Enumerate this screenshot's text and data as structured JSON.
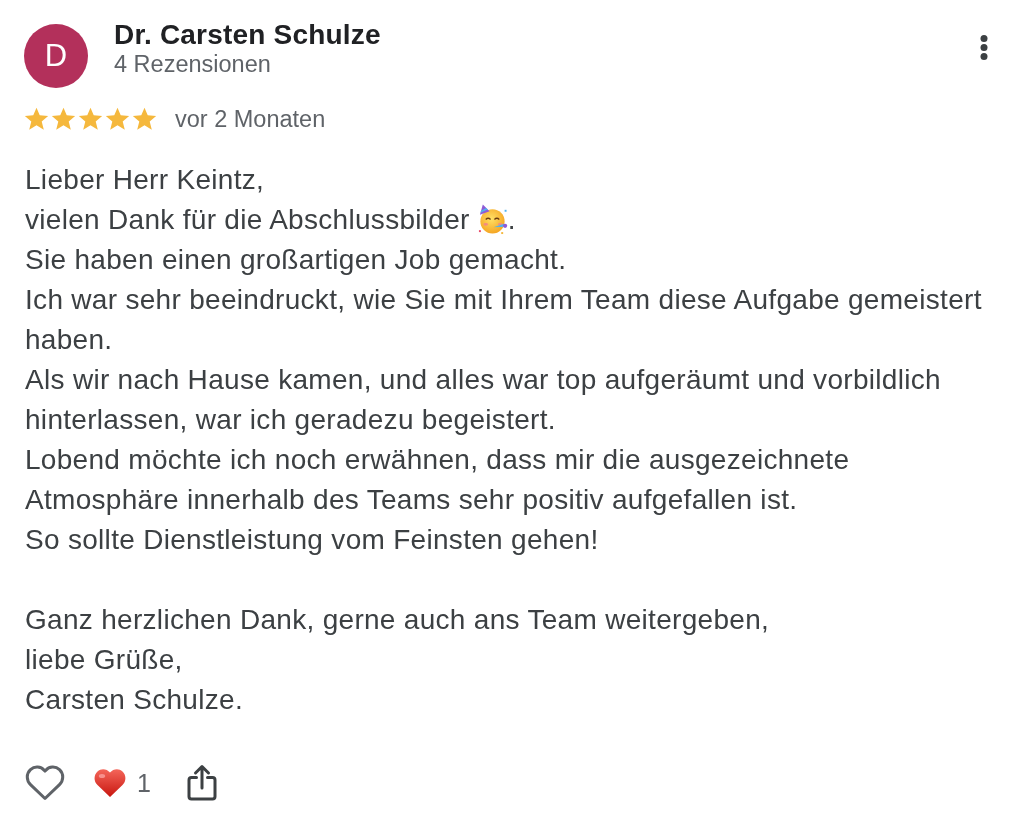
{
  "reviewer": {
    "avatar_letter": "D",
    "name": "Dr. Carsten Schulze",
    "review_count": "4 Rezensionen"
  },
  "rating": {
    "stars": 5,
    "time": "vor 2 Monaten"
  },
  "body": {
    "paragraphs": [
      [
        {
          "kind": "text",
          "text": "Lieber Herr Keintz,"
        },
        {
          "kind": "emoji",
          "text": "vielen Dank für die Abschlussbilder",
          "after": "."
        },
        {
          "kind": "text",
          "text": "Sie haben einen großartigen Job gemacht."
        },
        {
          "kind": "text",
          "text": "Ich war sehr beeindruckt, wie Sie mit Ihrem Team diese Aufgabe gemeistert\nhaben."
        },
        {
          "kind": "text",
          "text": "Als wir nach Hause kamen, und alles war top aufgeräumt und vorbildlich\nhinterlassen, war ich geradezu begeistert."
        },
        {
          "kind": "text",
          "text": "Lobend möchte ich noch erwähnen, dass mir die ausgezeichnete\nAtmosphäre innerhalb des Teams sehr positiv aufgefallen ist."
        },
        {
          "kind": "text",
          "text": "So sollte Dienstleistung vom Feinsten gehen!"
        }
      ],
      [
        {
          "kind": "text",
          "text": "Ganz herzlichen Dank, gerne auch ans Team weitergeben,"
        },
        {
          "kind": "text",
          "text": "liebe Grüße,"
        },
        {
          "kind": "text",
          "text": "Carsten Schulze."
        }
      ]
    ]
  },
  "actions": {
    "reactions": [
      {
        "kind": "heart",
        "count": "1"
      }
    ]
  }
}
